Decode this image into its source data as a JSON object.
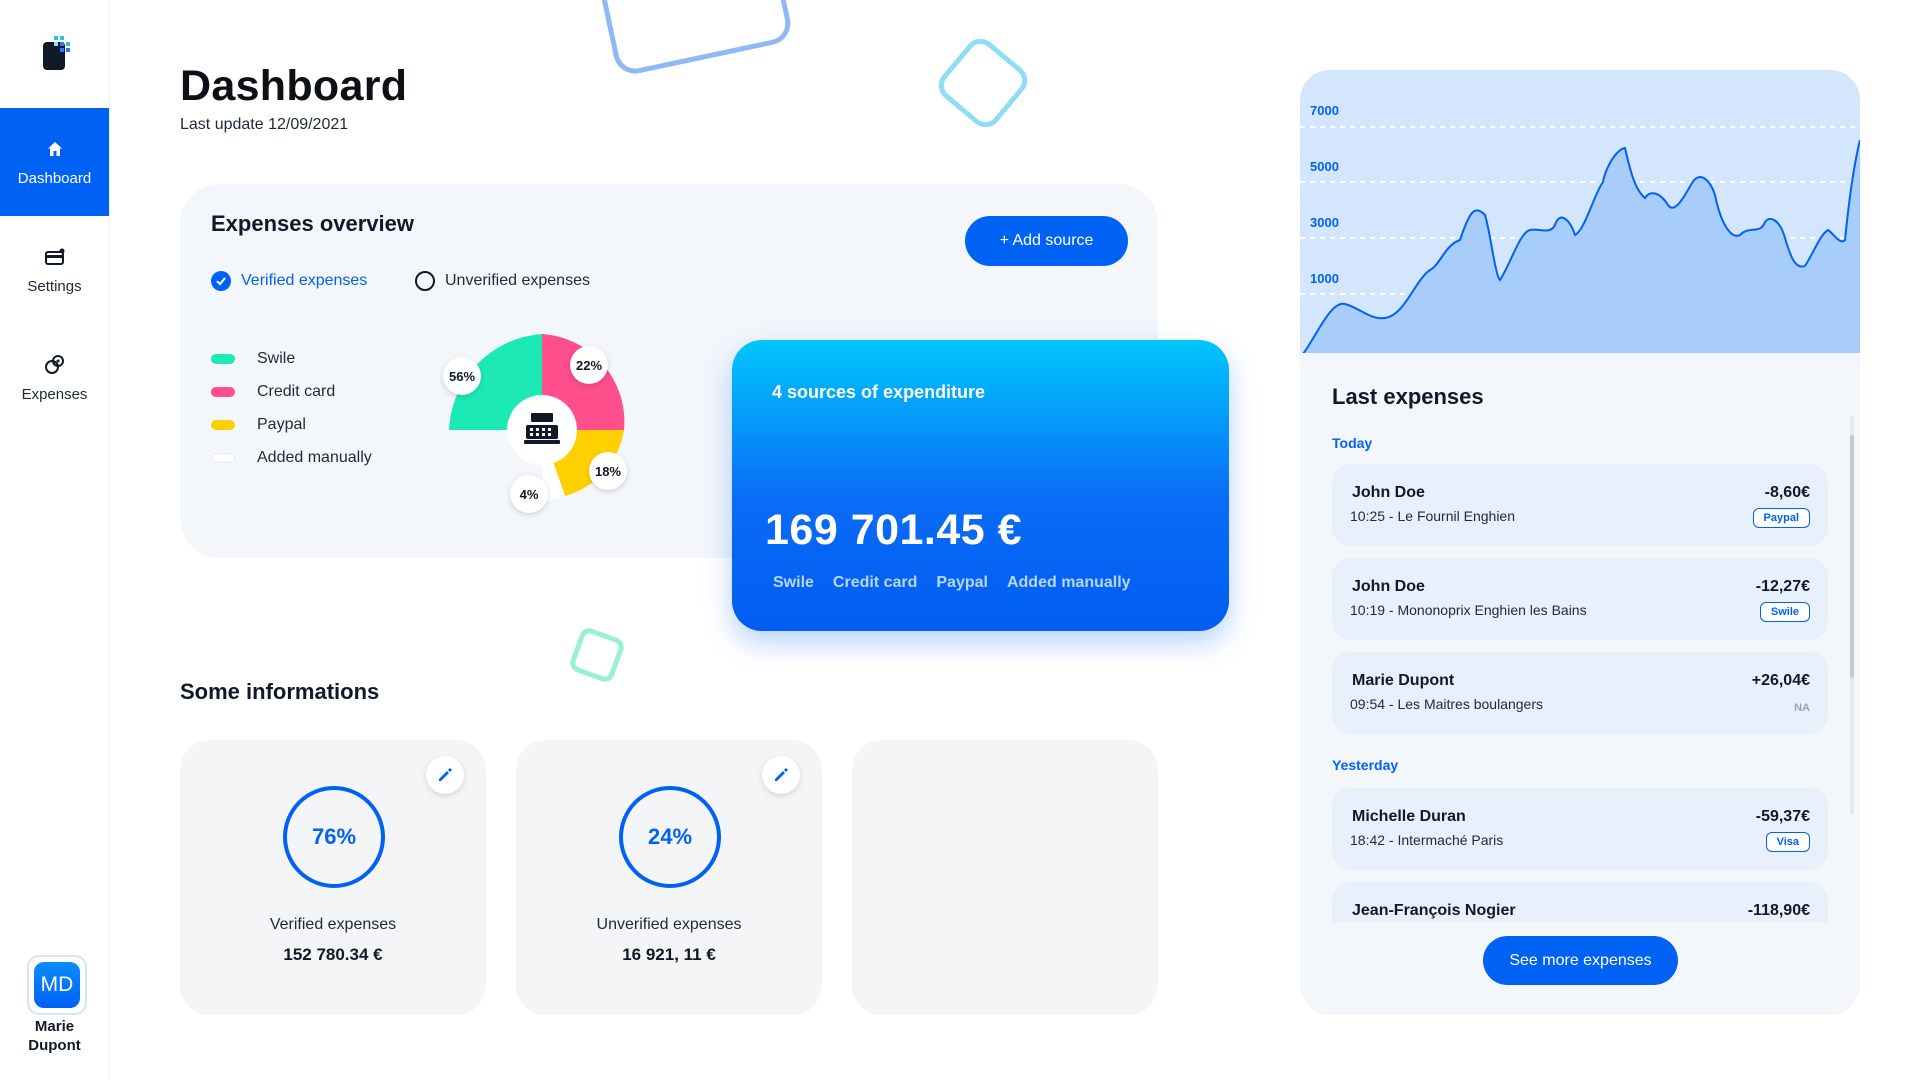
{
  "sidebar": {
    "items": [
      {
        "label": "Dashboard",
        "icon": "home-icon"
      },
      {
        "label": "Settings",
        "icon": "card-icon"
      },
      {
        "label": "Expenses",
        "icon": "coins-icon"
      }
    ],
    "user": {
      "initials": "MD",
      "name": "Marie Dupont"
    }
  },
  "header": {
    "title": "Dashboard",
    "subtitle": "Last update 12/09/2021"
  },
  "overview": {
    "title": "Expenses overview",
    "add_source_label": "+ Add source",
    "filters": {
      "verified": "Verified expenses",
      "unverified": "Unverified expenses"
    },
    "legend": [
      {
        "label": "Swile",
        "color": "#1de9b6"
      },
      {
        "label": "Credit card",
        "color": "#ff4e8c"
      },
      {
        "label": "Paypal",
        "color": "#ffd000"
      },
      {
        "label": "Added manually",
        "color": "#ffffff"
      }
    ],
    "donut_labels": {
      "swile": "56%",
      "credit_card": "22%",
      "paypal": "18%",
      "manual": "4%"
    }
  },
  "blue_card": {
    "title": "4 sources of expenditure",
    "total": "169 701.45 €",
    "sources": [
      "Swile",
      "Credit card",
      "Paypal",
      "Added manually"
    ]
  },
  "infos": {
    "title": "Some informations",
    "cards": [
      {
        "percent": "76%",
        "label": "Verified expenses",
        "value": "152 780.34 €"
      },
      {
        "percent": "24%",
        "label": "Unverified expenses",
        "value": "16 921, 11 €"
      }
    ]
  },
  "chart_data": {
    "type": "area",
    "y_ticks": [
      "7000",
      "5000",
      "3000",
      "1000"
    ]
  },
  "last_expenses": {
    "title": "Last expenses",
    "today_label": "Today",
    "yesterday_label": "Yesterday",
    "items": [
      {
        "name": "John Doe",
        "details": "10:25 - Le Fournil Enghien",
        "amount": "-8,60€",
        "badge": "Paypal"
      },
      {
        "name": "John Doe",
        "details": "10:19 - Mononoprix Enghien les Bains",
        "amount": "-12,27€",
        "badge": "Swile"
      },
      {
        "name": "Marie Dupont",
        "details": "09:54 - Les Maitres boulangers",
        "amount": "+26,04€",
        "badge": "NA"
      },
      {
        "name": "Michelle Duran",
        "details": "18:42 - Intermaché Paris",
        "amount": "-59,37€",
        "badge": "Visa"
      },
      {
        "name": "Jean-François Nogier",
        "details": "",
        "amount": "-118,90€",
        "badge": ""
      }
    ],
    "see_more_label": "See more expenses"
  },
  "colors": {
    "accent": "#0062f5",
    "swile": "#1de9b6",
    "credit_card": "#ff4e8c",
    "paypal": "#ffd000"
  }
}
